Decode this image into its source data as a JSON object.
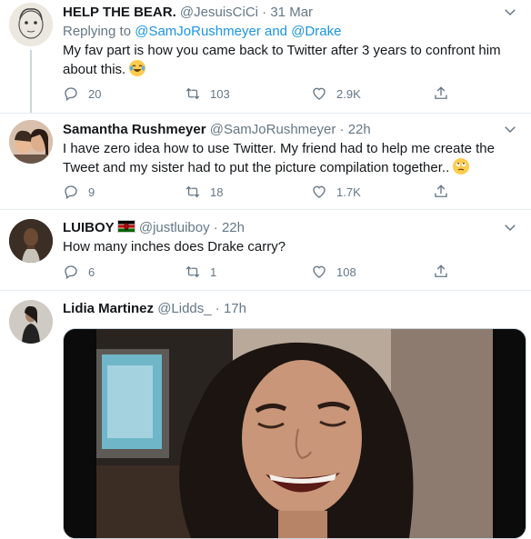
{
  "tweets": [
    {
      "name": "HELP THE BEAR.",
      "handle": "@JesuisCiCi",
      "sep": "·",
      "time": "31 Mar",
      "reply_prefix": "Replying to",
      "reply_user1": "@SamJoRushmeyer",
      "reply_and": "and",
      "reply_user2": "@Drake",
      "text": "My fav part is how you came back to Twitter after 3 years to confront him about this.",
      "emoji": "tears-of-joy-emoji",
      "replies": "20",
      "retweets": "103",
      "likes": "2.9K"
    },
    {
      "name": "Samantha Rushmeyer",
      "handle": "@SamJoRushmeyer",
      "sep": "·",
      "time": "22h",
      "text": "I have zero idea how to use Twitter. My friend had to help me create the Tweet and my sister had to put the picture compilation together..",
      "emoji": "eye-roll-emoji",
      "replies": "9",
      "retweets": "18",
      "likes": "1.7K"
    },
    {
      "name": "LUIBOY",
      "name_flag": "kenya-flag",
      "handle": "@justluiboy",
      "sep": "·",
      "time": "22h",
      "text": "How many inches does Drake carry?",
      "replies": "6",
      "retweets": "1",
      "likes": "108"
    },
    {
      "name": "Lidia Martinez",
      "handle": "@Lidds_",
      "sep": "·",
      "time": "17h",
      "media": "image-woman-laughing"
    }
  ],
  "colors": {
    "text": "#14171a",
    "secondary": "#657786",
    "link": "#1b95e0",
    "divider": "#e6ecf0"
  }
}
